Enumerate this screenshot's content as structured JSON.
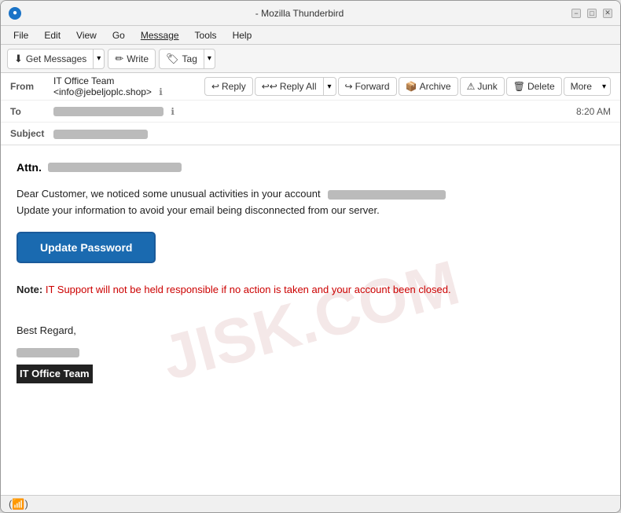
{
  "window": {
    "title": "- Mozilla Thunderbird",
    "icon_label": "TB"
  },
  "menu": {
    "items": [
      "File",
      "Edit",
      "View",
      "Go",
      "Message",
      "Tools",
      "Help"
    ]
  },
  "toolbar": {
    "get_messages_label": "Get Messages",
    "write_label": "Write",
    "tag_label": "Tag"
  },
  "email_header": {
    "from_label": "From",
    "from_value": "IT Office Team <info@jebeljoplc.shop>",
    "to_label": "To",
    "subject_label": "Subject",
    "time": "8:20 AM"
  },
  "action_buttons": {
    "reply_label": "Reply",
    "reply_all_label": "Reply All",
    "forward_label": "Forward",
    "archive_label": "Archive",
    "junk_label": "Junk",
    "delete_label": "Delete",
    "more_label": "More"
  },
  "email_body": {
    "attn_label": "Attn.",
    "body_line1": "Dear Customer, we noticed some unusual activities in your account",
    "body_line2": "Update your information to avoid your email being disconnected from our server.",
    "update_button_label": "Update Password",
    "note_label": "Note:",
    "note_text": " IT Support will not be held responsible if no action is taken and your account been closed.",
    "regards_line1": "Best Regard,",
    "regards_line2": "",
    "it_office_label": "IT Office Team"
  },
  "watermark_text": "JISK.COM",
  "status_bar": {
    "icon": "📶"
  }
}
